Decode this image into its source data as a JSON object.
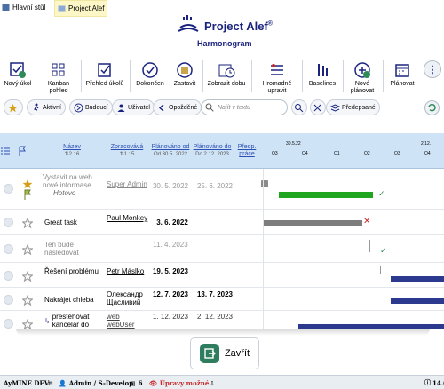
{
  "tabs": [
    {
      "label": "Hlavní stůl"
    },
    {
      "label": "Project Alef"
    }
  ],
  "header": {
    "title": "Project Alef",
    "title_sup": "®",
    "subtitle": "Harmonogram"
  },
  "toolbar": {
    "items": [
      {
        "label": "Nový úkol",
        "icon": "new-task-icon"
      },
      {
        "label": "Kanban pohled",
        "icon": "kanban-icon"
      },
      {
        "label": "Přehled úkolů",
        "icon": "task-overview-icon"
      },
      {
        "label": "Dokončen",
        "icon": "check-circle-icon"
      },
      {
        "label": "Zastavit",
        "icon": "stop-icon"
      },
      {
        "label": "Zobrazit dobu",
        "icon": "clock-icon"
      },
      {
        "label": "Hromadně upravit",
        "icon": "bulk-edit-icon"
      },
      {
        "label": "Baselines",
        "icon": "baselines-icon"
      },
      {
        "label": "Nové plánovat",
        "icon": "new-plan-icon"
      },
      {
        "label": "Plánovat",
        "icon": "calendar-icon"
      }
    ],
    "more_label": "⋮"
  },
  "filters": {
    "aktivni": "Aktivní",
    "budouci": "Budoucí",
    "uzivatel": "Uživatel",
    "opozdene": "Opožděné",
    "search_placeholder": "Najít v textu",
    "predepsane": "Předepsané"
  },
  "grid": {
    "headers": {
      "nazev": "Název",
      "nazev_sub": "⇅2 : 6",
      "zpracovava": "Zpracovává",
      "zpracovava_sub": "⇅1 : 5",
      "planovano_od": "Plánováno od",
      "planovano_od_sub": "Od 30.5. 2022",
      "planovano_do": "Plánováno do",
      "planovano_do_sub": "Do 2.12. 2023",
      "predp_prace": "Předp. práce"
    },
    "timeline_labels": [
      "30.5.22",
      "Q3",
      "Q4",
      "Q1",
      "Q2",
      "Q3",
      "2.12.",
      "Q4"
    ],
    "rows": [
      {
        "name": "Vystavit na web nové informase",
        "note": "Hotovo",
        "responsible": "Super Admin",
        "from": "30. 5. 2022",
        "to": "25. 6. 2022",
        "muted": true
      },
      {
        "name": "Great task",
        "note": "",
        "responsible": "Paul Monkey",
        "from": "3. 6. 2022",
        "to": "",
        "muted": false
      },
      {
        "name": "Ten bude následovat",
        "note": "",
        "responsible": "",
        "from": "11. 4. 2023",
        "to": "",
        "muted": true
      },
      {
        "name": "Řešení problému",
        "note": "",
        "responsible": "Petr Máslko",
        "from": "19. 5. 2023",
        "to": "",
        "muted": false
      },
      {
        "name": "Nakrájet chleba",
        "note": "",
        "responsible": "Олександр Щасливий",
        "from": "12. 7. 2023",
        "to": "13. 7. 2023",
        "muted": false
      },
      {
        "name": "přestěhovat kancelář do",
        "note": "",
        "responsible": "web webUser",
        "from": "1. 12. 2023",
        "to": "2. 12. 2023",
        "muted": false
      }
    ]
  },
  "close_button": {
    "label": "Zavřít"
  },
  "statusbar": {
    "app": "AyMINE DEV",
    "user": "Admin / S-Develop",
    "count": "6",
    "mode": "Úpravy možné",
    "version": "14.0"
  },
  "colors": {
    "accent": "#1a237e",
    "green": "#1fa51f",
    "navy": "#2b3a8f",
    "grey": "#7d7d7d",
    "header_bg": "#cfe3f6"
  }
}
